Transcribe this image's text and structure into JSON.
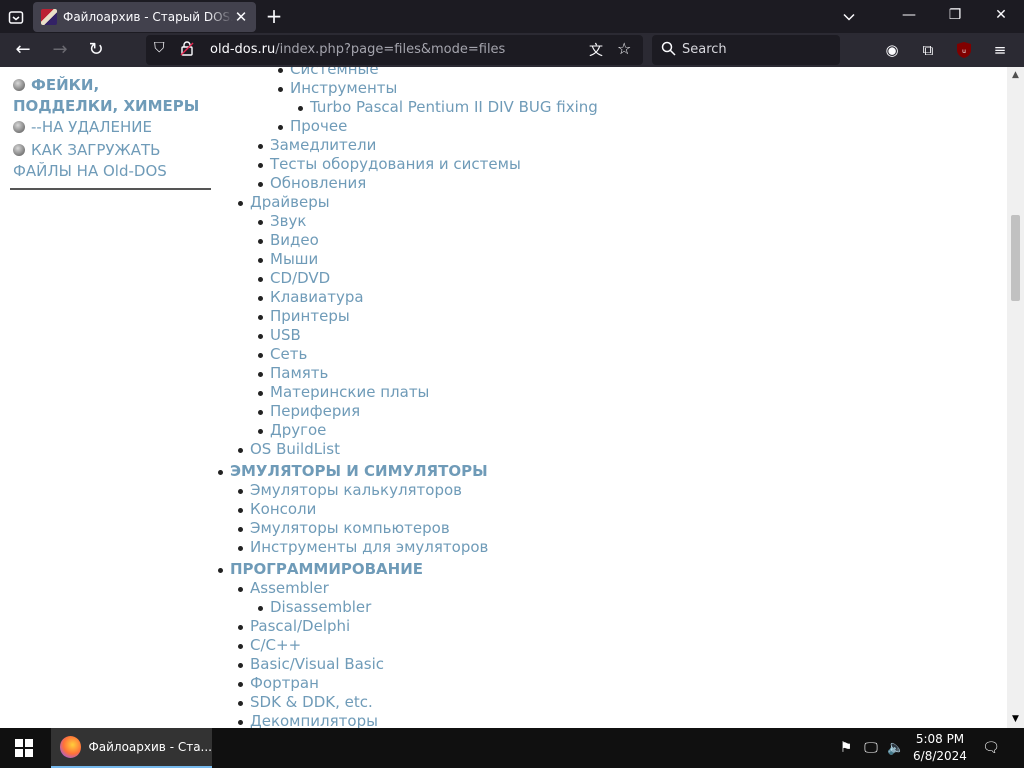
{
  "browser": {
    "tab_title": "Файлоархив - Старый DOS. Ab",
    "url_host": "old-dos.ru",
    "url_path": "/index.php?page=files&mode=files",
    "search_placeholder": "Search"
  },
  "sidebar": {
    "items": [
      {
        "label": "ФЕЙКИ, ПОДДЕЛКИ, ХИМЕРЫ",
        "bold": true
      },
      {
        "label": "--НА УДАЛЕНИЕ",
        "bold": false
      },
      {
        "label": "КАК ЗАГРУЖАТЬ ФАЙЛЫ НА Old-DOS",
        "bold": false
      }
    ]
  },
  "tree": [
    {
      "label": "Системные",
      "level": 3
    },
    {
      "label": "Инструменты",
      "level": 3
    },
    {
      "label": "Turbo Pascal Pentium II DIV BUG fixing",
      "level": 4
    },
    {
      "label": "Прочее",
      "level": 3
    },
    {
      "label": "Замедлители",
      "level": 2
    },
    {
      "label": "Тесты оборудования и системы",
      "level": 2
    },
    {
      "label": "Обновления",
      "level": 2
    },
    {
      "label": "Драйверы",
      "level": 1
    },
    {
      "label": "Звук",
      "level": 2
    },
    {
      "label": "Видео",
      "level": 2
    },
    {
      "label": "Мыши",
      "level": 2
    },
    {
      "label": "CD/DVD",
      "level": 2
    },
    {
      "label": "Клавиатура",
      "level": 2
    },
    {
      "label": "Принтеры",
      "level": 2
    },
    {
      "label": "USB",
      "level": 2
    },
    {
      "label": "Сеть",
      "level": 2
    },
    {
      "label": "Память",
      "level": 2
    },
    {
      "label": "Материнские платы",
      "level": 2
    },
    {
      "label": "Периферия",
      "level": 2
    },
    {
      "label": "Другое",
      "level": 2
    },
    {
      "label": "OS BuildList",
      "level": 1
    },
    {
      "label": "ЭМУЛЯТОРЫ И СИМУЛЯТОРЫ",
      "level": 0,
      "heading": true
    },
    {
      "label": "Эмуляторы калькуляторов",
      "level": 1
    },
    {
      "label": "Консоли",
      "level": 1
    },
    {
      "label": "Эмуляторы компьютеров",
      "level": 1
    },
    {
      "label": "Инструменты для эмуляторов",
      "level": 1
    },
    {
      "label": "ПРОГРАММИРОВАНИЕ",
      "level": 0,
      "heading": true
    },
    {
      "label": "Assembler",
      "level": 1
    },
    {
      "label": "Disassembler",
      "level": 2
    },
    {
      "label": "Pascal/Delphi",
      "level": 1
    },
    {
      "label": "C/C++",
      "level": 1
    },
    {
      "label": "Basic/Visual Basic",
      "level": 1
    },
    {
      "label": "Фортран",
      "level": 1
    },
    {
      "label": "SDK & DDK, etc.",
      "level": 1
    },
    {
      "label": "Декомпиляторы",
      "level": 1
    }
  ],
  "taskbar": {
    "app_label": "Файлоархив - Ста...",
    "time": "5:08 PM",
    "date": "6/8/2024"
  }
}
